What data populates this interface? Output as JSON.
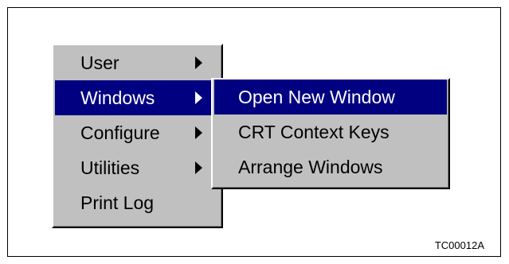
{
  "main_menu": {
    "items": [
      {
        "label": "User",
        "has_submenu": true,
        "selected": false
      },
      {
        "label": "Windows",
        "has_submenu": true,
        "selected": true
      },
      {
        "label": "Configure",
        "has_submenu": true,
        "selected": false
      },
      {
        "label": "Utilities",
        "has_submenu": true,
        "selected": false
      },
      {
        "label": "Print Log",
        "has_submenu": false,
        "selected": false
      }
    ]
  },
  "windows_submenu": {
    "items": [
      {
        "label": "Open New Window",
        "selected": true
      },
      {
        "label": "CRT Context Keys",
        "selected": false
      },
      {
        "label": "Arrange Windows",
        "selected": false
      }
    ]
  },
  "figure_code": "TC00012A",
  "colors": {
    "menu_background": "#c0c0c0",
    "highlight": "#000080",
    "highlight_text": "#ffffff"
  },
  "icons": {
    "submenu_arrow": "triangle-right-icon"
  }
}
